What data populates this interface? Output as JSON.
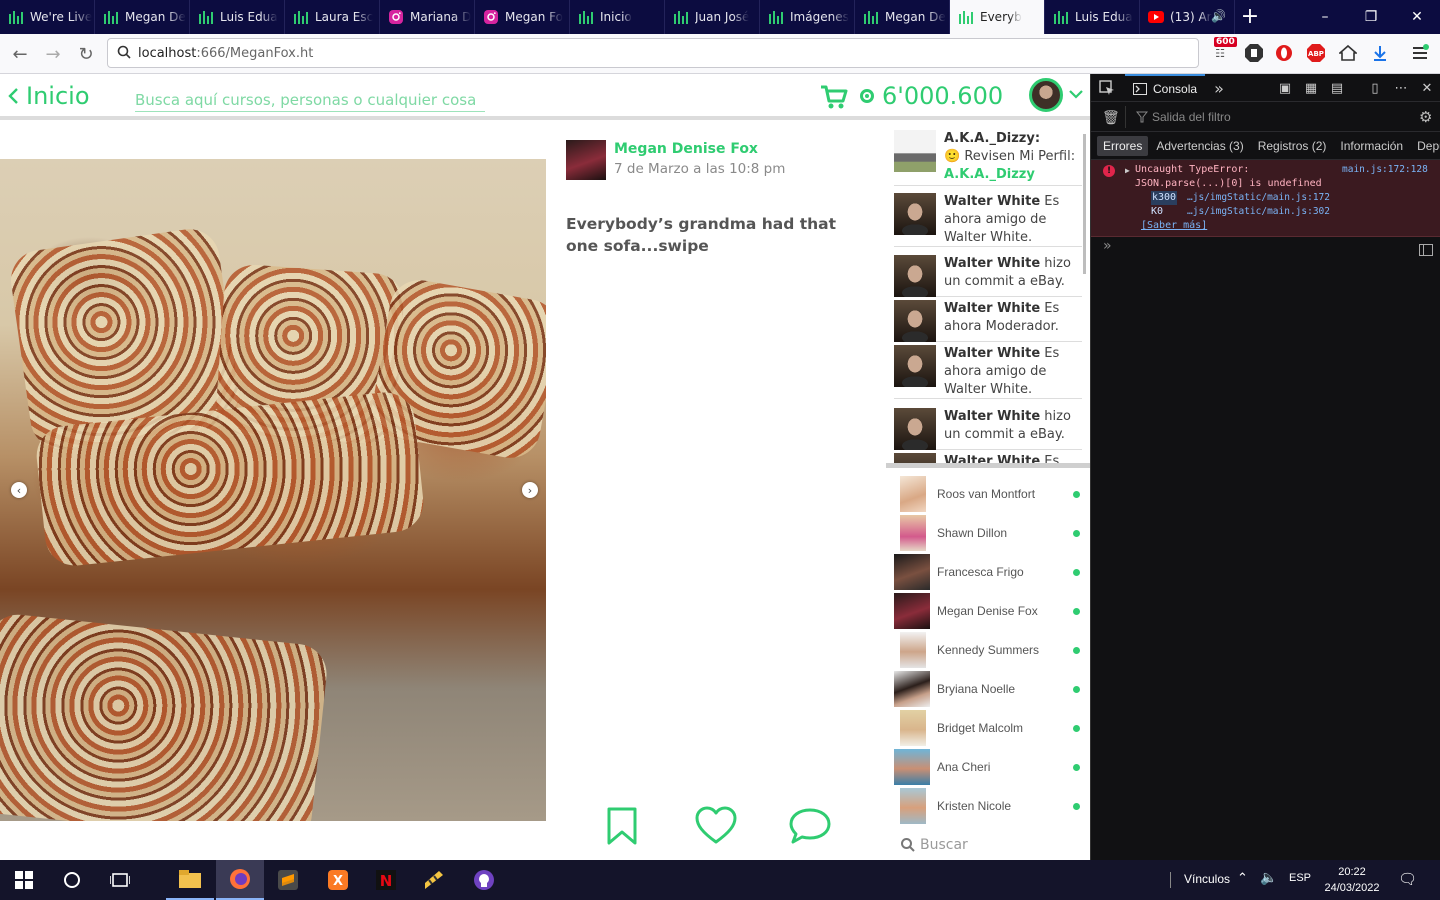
{
  "browser": {
    "tabs": [
      {
        "label": "We're Live",
        "icon": "bars-icon",
        "active": false
      },
      {
        "label": "Megan De",
        "icon": "bars-icon",
        "active": false
      },
      {
        "label": "Luis Edua",
        "icon": "bars-icon",
        "active": false
      },
      {
        "label": "Laura Esc",
        "icon": "bars-icon",
        "active": false
      },
      {
        "label": "Mariana D",
        "icon": "instagram-icon",
        "active": false
      },
      {
        "label": "Megan Fo",
        "icon": "instagram-icon",
        "active": false
      },
      {
        "label": "Inicio",
        "icon": "bars-icon",
        "active": false
      },
      {
        "label": "Juan José",
        "icon": "bars-icon",
        "active": false
      },
      {
        "label": "Imágenes",
        "icon": "bars-icon",
        "active": false
      },
      {
        "label": "Megan De",
        "icon": "bars-icon",
        "active": false
      },
      {
        "label": "Everyb",
        "icon": "bars-icon",
        "active": true
      },
      {
        "label": "Luis Edua",
        "icon": "bars-icon",
        "active": false
      },
      {
        "label": "(13) Ar",
        "icon": "youtube-icon",
        "active": false
      }
    ],
    "url": {
      "host": "localhost",
      "rest": ":666/MeganFox.ht"
    },
    "badge": "600",
    "accent": "#2fcc71"
  },
  "app": {
    "back_label": "Inicio",
    "search_placeholder": "Busca aquí cursos, personas o cualquier cosa",
    "coins": "6'000.600"
  },
  "post": {
    "author": "Megan Denise Fox",
    "date": "7 de Marzo a las 10:8 pm",
    "text": "Everybody’s grandma had that one sofa...swipe"
  },
  "notifications": [
    {
      "name": "A.K.A._Dizzy:",
      "emoji": "🙂",
      "body": "Revisen Mi Perfil:",
      "link": "A.K.A._Dizzy"
    },
    {
      "name": "Walter White",
      "body": "Es ahora amigo de Walter White."
    },
    {
      "name": "Walter White",
      "body": "hizo un commit a eBay."
    },
    {
      "name": "Walter White",
      "body": "Es ahora Moderador."
    },
    {
      "name": "Walter White",
      "body": "Es ahora amigo de Walter White."
    },
    {
      "name": "Walter White",
      "body": "hizo un commit a eBay."
    },
    {
      "name": "Walter White",
      "body": "Es"
    }
  ],
  "contacts": [
    {
      "name": "Roos van Montfort"
    },
    {
      "name": "Shawn Dillon"
    },
    {
      "name": "Francesca Frigo"
    },
    {
      "name": "Megan Denise Fox"
    },
    {
      "name": "Kennedy Summers"
    },
    {
      "name": "Bryiana Noelle"
    },
    {
      "name": "Bridget Malcolm"
    },
    {
      "name": "Ana Cheri"
    },
    {
      "name": "Kristen Nicole"
    }
  ],
  "contact_search_placeholder": "Buscar",
  "devtools": {
    "console_tab": "Consola",
    "filter_placeholder": "Salida del filtro",
    "levels": [
      "Errores",
      "Advertencias (3)",
      "Registros (2)",
      "Información",
      "Depurar"
    ],
    "error": {
      "line1": "Uncaught TypeError:",
      "line2": "JSON.parse(...)[0] is undefined",
      "source": "main.js:172:128",
      "stack": [
        {
          "fn": "k300",
          "loc": "…js/imgStatic/main.js:172"
        },
        {
          "fn": "K0",
          "loc": "…js/imgStatic/main.js:302"
        }
      ],
      "more": "[Saber más]"
    }
  },
  "taskbar": {
    "tray_label": "Vínculos",
    "lang": "ESP",
    "time": "20:22",
    "date": "24/03/2022"
  }
}
